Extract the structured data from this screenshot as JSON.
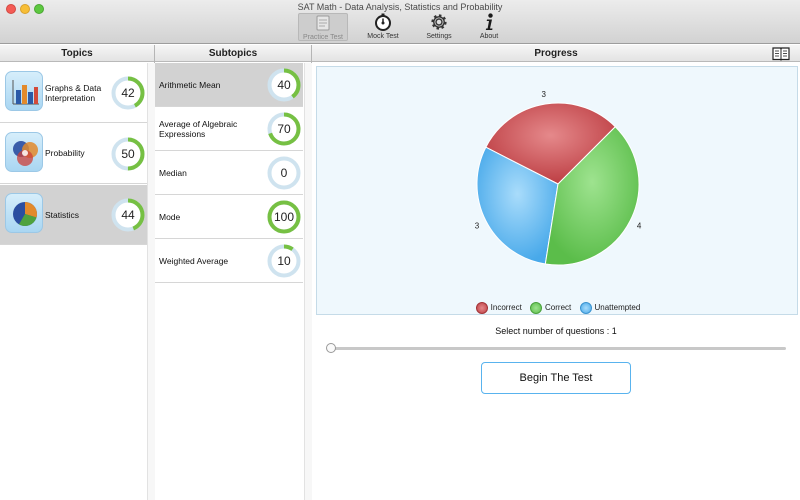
{
  "window": {
    "title": "SAT Math - Data Analysis, Statistics and Probability"
  },
  "toolbar": {
    "items": [
      {
        "label": "Practice Test",
        "icon": "practice-test-icon",
        "active": true
      },
      {
        "label": "Mock Test",
        "icon": "stopwatch-icon",
        "active": false
      },
      {
        "label": "Settings",
        "icon": "gear-icon",
        "active": false
      },
      {
        "label": "About",
        "icon": "info-icon",
        "active": false
      }
    ]
  },
  "topics": {
    "header": "Topics",
    "items": [
      {
        "label": "Graphs & Data Interpretation",
        "score": "42",
        "percent": 42,
        "icon": "bar-chart-icon"
      },
      {
        "label": "Probability",
        "score": "50",
        "percent": 50,
        "icon": "venn-diagram-icon"
      },
      {
        "label": "Statistics",
        "score": "44",
        "percent": 44,
        "icon": "pie-chart-icon",
        "selected": true
      }
    ]
  },
  "subtopics": {
    "header": "Subtopics",
    "items": [
      {
        "label": "Arithmetic Mean",
        "score": "40",
        "percent": 40,
        "selected": true
      },
      {
        "label": "Average of Algebraic Expressions",
        "score": "70",
        "percent": 70
      },
      {
        "label": "Median",
        "score": "0",
        "percent": 0
      },
      {
        "label": "Mode",
        "score": "100",
        "percent": 100
      },
      {
        "label": "Weighted Average",
        "score": "10",
        "percent": 10
      }
    ]
  },
  "progress": {
    "header": "Progress",
    "header_icon": "book-icon",
    "select_label": "Select number of questions : 1",
    "slider_value": 1,
    "begin_button": "Begin The Test"
  },
  "chart_data": {
    "type": "pie",
    "categories": [
      "Incorrect",
      "Unattempted",
      "Correct"
    ],
    "values": [
      3,
      3,
      4
    ],
    "colors": {
      "Incorrect": "#c9474b",
      "Correct": "#6cc85a",
      "Unattempted": "#59b3ee"
    },
    "legend": [
      "Incorrect",
      "Correct",
      "Unattempted"
    ],
    "legend_position": "bottom-center"
  },
  "colors": {
    "ring_progress": "#76c043",
    "ring_track": "#cfe3ef",
    "accent_blue": "#59b3ee"
  }
}
